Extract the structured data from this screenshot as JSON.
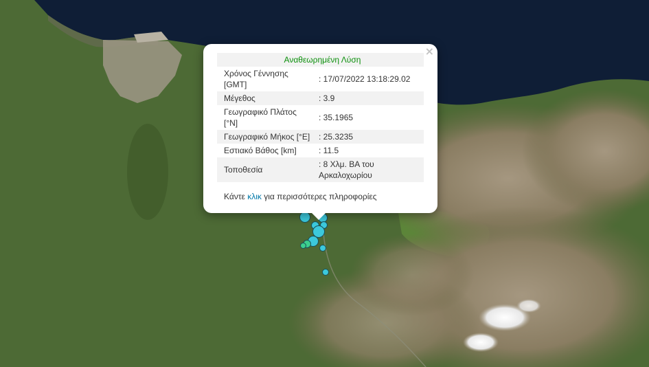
{
  "popup": {
    "status": "Αναθεωρημένη Λύση",
    "close_symbol": "×",
    "rows": [
      {
        "label": "Χρόνος Γέννησης [GMT]",
        "value": ": 17/07/2022 13:18:29.02"
      },
      {
        "label": "Μέγεθος",
        "value": ": 3.9"
      },
      {
        "label": "Γεωγραφικό Πλάτος [°N]",
        "value": ": 35.1965"
      },
      {
        "label": "Γεωγραφικό Μήκος [°E]",
        "value": ": 25.3235"
      },
      {
        "label": "Εστιακό Βάθος [km]",
        "value": ": 11.5"
      },
      {
        "label": "Τοποθεσία",
        "value": ": 8 Χλμ. ΒΑ του Αρκαλοχωρίου"
      }
    ],
    "more": {
      "prefix": "Κάντε ",
      "link": "κλικ",
      "suffix": " για περισσότερες πληροφορίες"
    }
  },
  "map": {
    "layer": "satellite",
    "marker_color": "#3cc9dc",
    "marker_color_alt": "#3ccf8e",
    "sea_color": "#0f1e36"
  }
}
